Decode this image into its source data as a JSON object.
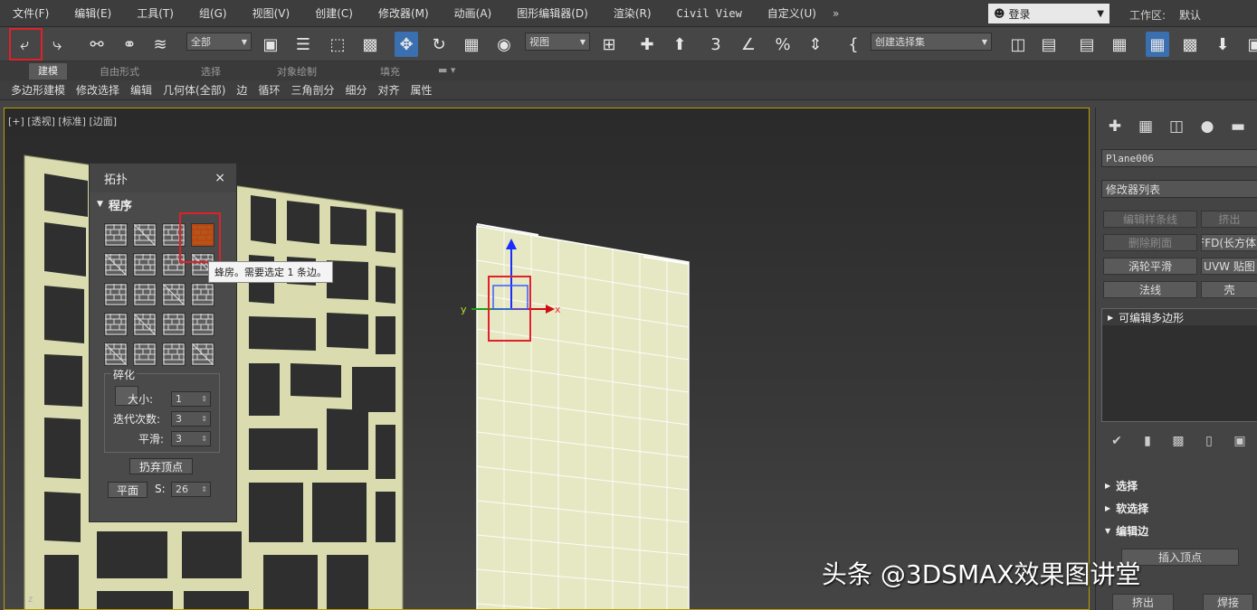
{
  "menu": [
    "文件(F)",
    "编辑(E)",
    "工具(T)",
    "组(G)",
    "视图(V)",
    "创建(C)",
    "修改器(M)",
    "动画(A)",
    "图形编辑器(D)",
    "渲染(R)",
    "Civil View",
    "自定义(U)"
  ],
  "menu_more": "»",
  "login": "登录",
  "workspace_label": "工作区:",
  "workspace_value": "默认",
  "toolbar": {
    "selection_filter": "全部",
    "ref_coord": "视图",
    "named_selection": "创建选择集",
    "snap_3": "3",
    "snap_angle": "∠",
    "snap_percent": "%"
  },
  "ribbon": {
    "tabs": [
      "建模",
      "自由形式",
      "选择",
      "对象绘制",
      "填充"
    ],
    "subitems": [
      "多边形建模",
      "修改选择",
      "编辑",
      "几何体(全部)",
      "边",
      "循环",
      "三角剖分",
      "细分",
      "对齐",
      "属性"
    ]
  },
  "viewport": {
    "label": "[+] [透视] [标准] [边面]",
    "axis_x": "x",
    "axis_y": "y",
    "axis_z": "z"
  },
  "topology": {
    "title": "拓扑",
    "close": "×",
    "section": "程序",
    "tooltip": "蜂房。需要选定 1 条边。",
    "frag_label": "碎化",
    "size_label": "大小:",
    "size_value": "1",
    "iter_label": "迭代次数:",
    "iter_value": "3",
    "smooth_label": "平滑:",
    "smooth_value": "3",
    "keep_verts": "扔弃顶点",
    "plane": "平面",
    "s_label": "S:",
    "s_value": "26"
  },
  "command_panel": {
    "object_name": "Plane006",
    "modifier_list": "修改器列表",
    "buttons": [
      "编辑样条线",
      "挤出",
      "删除刷面",
      "FFD(长方体)",
      "涡轮平滑",
      "UVW 贴图",
      "法线",
      "壳"
    ],
    "stack_item": "可编辑多边形",
    "rollouts": [
      "选择",
      "软选择",
      "编辑边"
    ],
    "insert_vertex": "插入顶点",
    "extrude": "挤出",
    "weld": "焊接"
  },
  "watermark": "头条 @3DSMAX效果图讲堂",
  "colors": {
    "highlight_red": "#e0202a",
    "active_blue": "#3a6fb0",
    "mesh_fill": "#e6e8c4",
    "viewport_border": "#b8a000"
  }
}
